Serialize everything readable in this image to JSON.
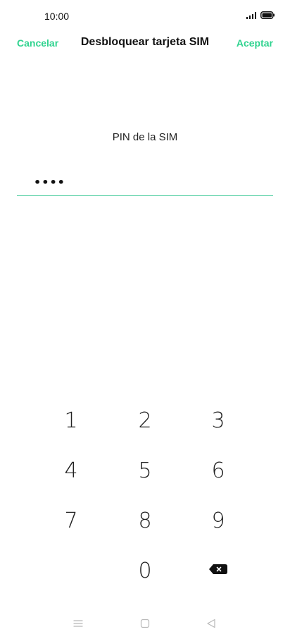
{
  "status_bar": {
    "time": "10:00",
    "signal_icon": "signal-bars-icon",
    "battery_icon": "battery-full-icon"
  },
  "header": {
    "cancel_label": "Cancelar",
    "title": "Desbloquear tarjeta SIM",
    "accept_label": "Aceptar",
    "accent_color": "#2fd38f"
  },
  "pin": {
    "label": "PIN de la SIM",
    "value": "••••"
  },
  "keypad": {
    "keys": [
      "1",
      "2",
      "3",
      "4",
      "5",
      "6",
      "7",
      "8",
      "9",
      "0"
    ],
    "backspace_icon": "backspace-icon"
  },
  "nav_bar": {
    "menu_icon": "menu-icon",
    "home_icon": "home-square-icon",
    "back_icon": "back-triangle-icon"
  }
}
